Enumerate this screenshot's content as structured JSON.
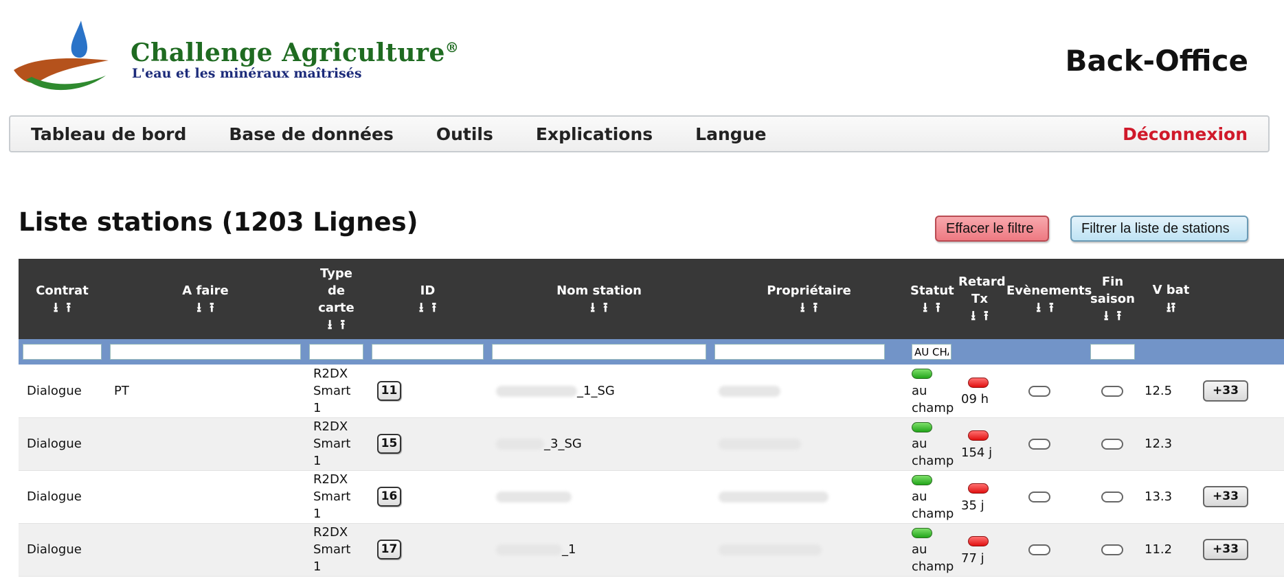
{
  "brand": {
    "title": "Challenge Agriculture",
    "reg": "®",
    "subtitle": "L'eau et les minéraux maîtrisés",
    "section": "Back-Office"
  },
  "nav": {
    "items": [
      "Tableau de bord",
      "Base de données",
      "Outils",
      "Explications",
      "Langue"
    ],
    "logout": "Déconnexion"
  },
  "list": {
    "title": "Liste stations (1203 Lignes)",
    "clear_filter": "Effacer le filtre",
    "filter_list": "Filtrer la liste de stations"
  },
  "table": {
    "headers": {
      "contrat": "Contrat",
      "afaire": "A faire",
      "type_l1": "Type",
      "type_l2": "de",
      "type_l3": "carte",
      "id": "ID",
      "nom": "Nom station",
      "proprietaire": "Propriétaire",
      "statut": "Statut",
      "retard_l1": "Retard",
      "retard_l2": "Tx",
      "evenements": "Evènements",
      "fin_l1": "Fin",
      "fin_l2": "saison",
      "vbat": "V bat"
    },
    "sort_icons": "⭳⭱",
    "filter_statut_value": "AU CHA",
    "rows": [
      {
        "contrat": "Dialogue",
        "afaire": "PT",
        "type_l1": "R2DX",
        "type_l2": "Smart 1",
        "id": "11",
        "nom": "_1_SG",
        "statut_l1": "au",
        "statut_l2": "champ",
        "retard": "09 h",
        "vbat": "12.5",
        "phone": "+33"
      },
      {
        "contrat": "Dialogue",
        "afaire": "",
        "type_l1": "R2DX",
        "type_l2": "Smart 1",
        "id": "15",
        "nom": "_3_SG",
        "statut_l1": "au",
        "statut_l2": "champ",
        "retard": "154 j",
        "vbat": "12.3",
        "phone": ""
      },
      {
        "contrat": "Dialogue",
        "afaire": "",
        "type_l1": "R2DX",
        "type_l2": "Smart 1",
        "id": "16",
        "nom": "",
        "statut_l1": "au",
        "statut_l2": "champ",
        "retard": "35 j",
        "vbat": "13.3",
        "phone": "+33"
      },
      {
        "contrat": "Dialogue",
        "afaire": "",
        "type_l1": "R2DX",
        "type_l2": "Smart 1",
        "id": "17",
        "nom": "_1",
        "statut_l1": "au",
        "statut_l2": "champ",
        "retard": "77 j",
        "vbat": "11.2",
        "phone": "+33"
      }
    ]
  },
  "colors": {
    "header_bg": "#383838",
    "filter_row_bg": "#7294c8",
    "logout": "#d0192a",
    "brand_green": "#1f6b21",
    "brand_blue": "#1c2b7a"
  }
}
